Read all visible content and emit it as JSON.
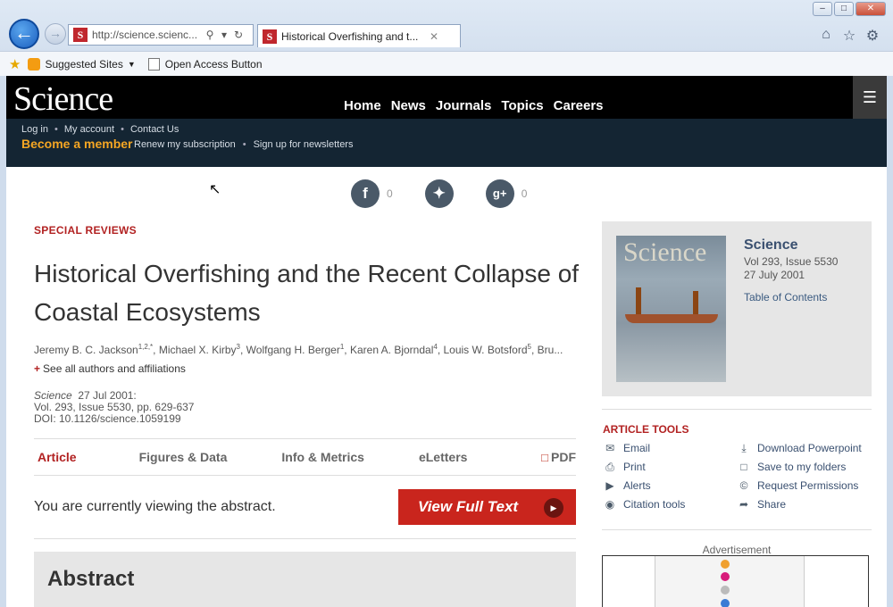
{
  "browser": {
    "address": "http://science.scienc...",
    "tab_title": "Historical Overfishing and t...",
    "favorites": {
      "suggested_sites": "Suggested Sites",
      "open_access": "Open Access Button"
    }
  },
  "site": {
    "logo": "Science",
    "nav": [
      "Home",
      "News",
      "Journals",
      "Topics",
      "Careers"
    ],
    "account_links": [
      "Log in",
      "My account",
      "Contact Us"
    ],
    "member": "Become a member",
    "member_links": [
      "Renew my subscription",
      "Sign up for newsletters"
    ]
  },
  "social": {
    "facebook_count": "0",
    "gplus_count": "0"
  },
  "article": {
    "kicker": "SPECIAL REVIEWS",
    "title": "Historical Overfishing and the Recent Collapse of Coastal Ecosystems",
    "authors_prefix": "Jeremy B. C. Jackson",
    "authors_rest": ", Michael X. Kirby",
    "authors_rest2": ", Wolfgang H. Berger",
    "authors_rest3": ", Karen A. Bjorndal",
    "authors_rest4": ", Louis W. Botsford",
    "authors_tail": ", Bru...",
    "sup1": "1,2,*",
    "sup2": "3",
    "sup3": "1",
    "sup4": "4",
    "sup5": "5",
    "see_all": "See all authors and affiliations",
    "journal": "Science",
    "date": "27 Jul 2001:",
    "volume": "Vol. 293, Issue 5530, pp. 629-637",
    "doi": "DOI: 10.1126/science.1059199",
    "tabs": [
      "Article",
      "Figures & Data",
      "Info & Metrics",
      "eLetters"
    ],
    "pdf": "PDF",
    "viewing_text": "You are currently viewing the abstract.",
    "full_text_btn": "View Full Text",
    "abstract_title": "Abstract"
  },
  "sidebar": {
    "cover_logo": "Science",
    "journal": "Science",
    "vol_issue": "Vol 293, Issue 5530",
    "issue_date": "27 July 2001",
    "toc": "Table of Contents",
    "tools_title": "ARTICLE TOOLS",
    "tools": [
      "Email",
      "Download Powerpoint",
      "Print",
      "Save to my folders",
      "Alerts",
      "Request Permissions",
      "Citation tools",
      "Share"
    ],
    "ad_label": "Advertisement"
  },
  "colors": {
    "accent_red": "#b22222",
    "header_dark": "#142533",
    "member_orange": "#f5a623",
    "link_blue": "#3a5070"
  }
}
